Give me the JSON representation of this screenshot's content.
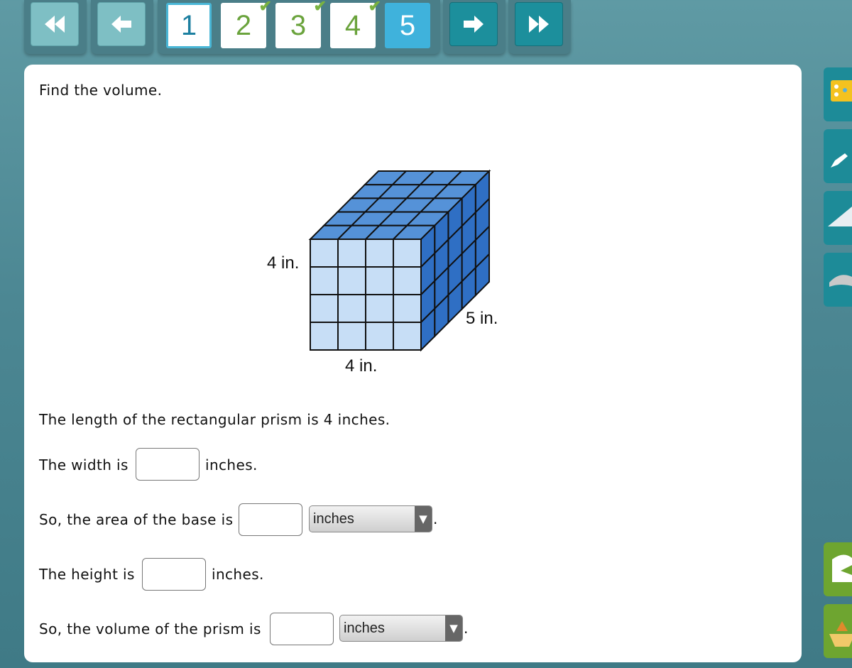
{
  "nav": {
    "first_icon": "double-chevron-left-icon",
    "back_icon": "arrow-left-icon",
    "next_icon": "arrow-right-icon",
    "last_icon": "double-chevron-right-icon",
    "questions": [
      {
        "label": "1",
        "checked": false,
        "state": "current"
      },
      {
        "label": "2",
        "checked": true,
        "state": "done"
      },
      {
        "label": "3",
        "checked": true,
        "state": "done"
      },
      {
        "label": "4",
        "checked": true,
        "state": "done"
      },
      {
        "label": "5",
        "checked": false,
        "state": "active"
      }
    ]
  },
  "question": {
    "prompt": "Find the volume.",
    "figure": {
      "height_label": "4 in.",
      "depth_label": "5 in.",
      "length_label": "4 in."
    },
    "statement": "The length of the rectangular prism is 4 inches.",
    "width_pre": "The width is",
    "width_post": "inches.",
    "area_pre": "So, the area of the base is",
    "area_unit": "inches",
    "height_pre": "The height is",
    "height_post": "inches.",
    "volume_pre": "So, the volume of the prism is",
    "volume_unit": "inches",
    "period": "."
  },
  "tools": [
    "calculator-icon",
    "pencil-icon",
    "glossary-icon",
    "hat-icon",
    "help-icon",
    "toolbox-icon"
  ]
}
